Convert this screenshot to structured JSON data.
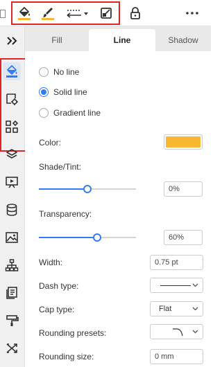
{
  "toolbar": {
    "buttons": [
      {
        "name": "fill-bucket-icon",
        "color": "#f7b731"
      },
      {
        "name": "line-brush-icon",
        "color": "#f7b731"
      },
      {
        "name": "arrow-style-icon"
      },
      {
        "name": "shadow-style-icon"
      },
      {
        "name": "lock-icon"
      },
      {
        "name": "more-icon"
      }
    ]
  },
  "rail": {
    "items": [
      {
        "name": "fill-line-icon",
        "active": true
      },
      {
        "name": "shape-settings-icon"
      },
      {
        "name": "apps-grid-icon"
      },
      {
        "name": "layers-icon"
      },
      {
        "name": "presentation-icon"
      },
      {
        "name": "database-icon"
      },
      {
        "name": "image-icon"
      },
      {
        "name": "hierarchy-icon"
      },
      {
        "name": "document-icon"
      },
      {
        "name": "format-painter-icon"
      },
      {
        "name": "shuffle-icon"
      }
    ]
  },
  "tabs": [
    {
      "label": "Fill"
    },
    {
      "label": "Line",
      "selected": true
    },
    {
      "label": "Shadow"
    }
  ],
  "line": {
    "options": [
      {
        "label": "No line",
        "checked": false
      },
      {
        "label": "Solid line",
        "checked": true
      },
      {
        "label": "Gradient line",
        "checked": false
      }
    ],
    "color_label": "Color:",
    "color_value": "#f7b731",
    "shade_label": "Shade/Tint:",
    "shade_value": "0%",
    "shade_level": 0.5,
    "transparency_label": "Transparency:",
    "transparency_value": "60%",
    "transparency_level": 0.6,
    "width_label": "Width:",
    "width_value": "0.75 pt",
    "dash_label": "Dash type:",
    "cap_label": "Cap type:",
    "cap_value": "Flat",
    "rounding_presets_label": "Rounding presets:",
    "rounding_size_label": "Rounding size:",
    "rounding_size_value": "0 mm"
  }
}
